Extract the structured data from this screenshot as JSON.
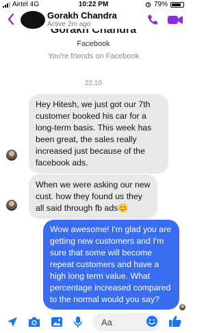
{
  "status_bar": {
    "carrier": "Airtel",
    "network": "4G",
    "time": "10:22 PM",
    "battery": "79%",
    "battery_level": 0.79
  },
  "header": {
    "contact_name": "Gorakh Chandra",
    "active_status": "Active 2m ago"
  },
  "profile": {
    "name": "Gorakh Chandra",
    "platform": "Facebook",
    "friend_status": "You're friends on Facebook"
  },
  "conversation": {
    "timestamp": "22:10",
    "messages": [
      {
        "direction": "incoming",
        "text": "Hey Hitesh, we just got our 7th customer booked his car for a long-term basis. This week has been great, the sales really increased just because of the facebook ads."
      },
      {
        "direction": "incoming",
        "text": "When we were asking our new cust. how they found us they all said through fb ads😊"
      },
      {
        "direction": "outgoing",
        "text": "Wow awesome! I'm glad you are getting new customers and I'm sure that some will become repeat customers and have a high long term value. What percentage increased compared to the normal would you say?"
      }
    ]
  },
  "composer": {
    "placeholder": "Aa"
  },
  "colors": {
    "accent": "#8a2be2",
    "outgoing_bubble": "#3a6cf0",
    "incoming_bubble": "#e9e9eb",
    "toolbar_icon": "#1877f2"
  },
  "icons": {
    "back": "chevron-left-icon",
    "call": "phone-icon",
    "video": "video-camera-icon",
    "location": "location-arrow-icon",
    "camera": "camera-icon",
    "gallery": "image-icon",
    "voice": "microphone-icon",
    "emoji": "smiley-icon",
    "like": "thumbs-up-icon"
  }
}
